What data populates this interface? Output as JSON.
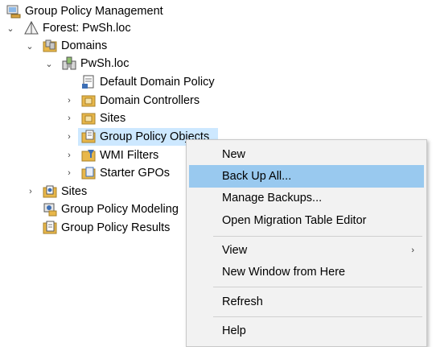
{
  "tree": {
    "root": "Group Policy Management",
    "forest": "Forest: PwSh.loc",
    "domains": "Domains",
    "domain": "PwSh.loc",
    "default_policy": "Default Domain Policy",
    "domain_controllers": "Domain Controllers",
    "sites_sub": "Sites",
    "gpo": "Group Policy Objects",
    "wmi": "WMI Filters",
    "starter": "Starter GPOs",
    "sites": "Sites",
    "modeling": "Group Policy Modeling",
    "results": "Group Policy Results"
  },
  "context_menu": {
    "new": "New",
    "back_up_all": "Back Up All...",
    "manage_backups": "Manage Backups...",
    "open_migration": "Open Migration Table Editor",
    "view": "View",
    "new_window": "New Window from Here",
    "refresh": "Refresh",
    "help": "Help",
    "submenu_arrow": "›"
  },
  "icons": {
    "folder_color": "#e8b74a",
    "selection_color": "#cde8ff",
    "menu_highlight": "#99c9ef"
  }
}
